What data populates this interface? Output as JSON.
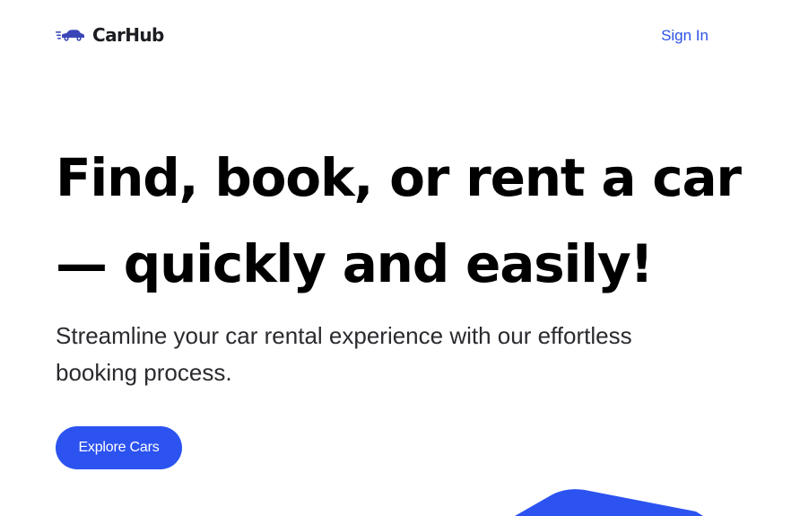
{
  "brand": {
    "name": "CarHub",
    "logo_icon": "car-logo-icon",
    "logo_color": "#3a46b8"
  },
  "nav": {
    "sign_in_label": "Sign In"
  },
  "hero": {
    "title_line1": "Find, book, or rent a car",
    "title_line2": "— quickly and easily!",
    "subtitle_line1": "Streamline your car rental experience with our effortless",
    "subtitle_line2": "booking process.",
    "cta_label": "Explore Cars"
  },
  "colors": {
    "accent": "#2c53f0",
    "link": "#2c53e6",
    "text": "#000000"
  },
  "decor": {
    "icon": "blue-shape-decoration"
  }
}
